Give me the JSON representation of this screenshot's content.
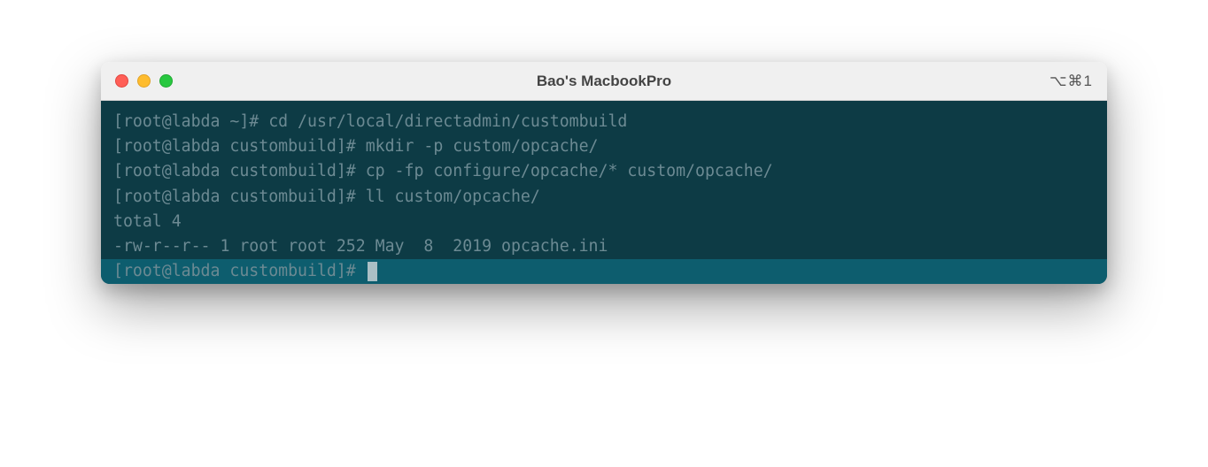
{
  "window": {
    "title": "Bao's MacbookPro",
    "shortcut": "⌥⌘1"
  },
  "terminal": {
    "lines": [
      {
        "prompt": "[root@labda ~]#",
        "command": " cd /usr/local/directadmin/custombuild"
      },
      {
        "prompt": "[root@labda custombuild]#",
        "command": " mkdir -p custom/opcache/"
      },
      {
        "prompt": "[root@labda custombuild]#",
        "command": " cp -fp configure/opcache/* custom/opcache/"
      },
      {
        "prompt": "[root@labda custombuild]#",
        "command": " ll custom/opcache/"
      }
    ],
    "output": [
      "total 4",
      "-rw-r--r-- 1 root root 252 May  8  2019 opcache.ini"
    ],
    "current_prompt": "[root@labda custombuild]# "
  }
}
